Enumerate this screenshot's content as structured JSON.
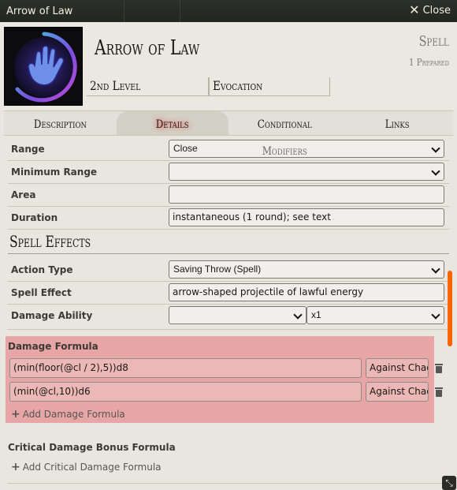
{
  "window": {
    "title": "Arrow of Law",
    "close_label": "Close"
  },
  "header": {
    "name": "Arrow of Law",
    "type": "Spell",
    "status": "1 Prepared",
    "level": "2nd Level",
    "school": "Evocation"
  },
  "tabs": [
    {
      "label": "Description",
      "active": false
    },
    {
      "label": "Details",
      "active": true
    },
    {
      "label": "Conditional Modifiers",
      "active": false
    },
    {
      "label": "Links",
      "active": false
    }
  ],
  "fields": {
    "range": {
      "label": "Range",
      "value": "Close"
    },
    "min_range": {
      "label": "Minimum Range",
      "value": ""
    },
    "area": {
      "label": "Area",
      "value": ""
    },
    "duration": {
      "label": "Duration",
      "value": "instantaneous (1 round); see text"
    }
  },
  "spell_effects": {
    "heading": "Spell Effects",
    "action_type": {
      "label": "Action Type",
      "value": "Saving Throw (Spell)"
    },
    "spell_effect": {
      "label": "Spell Effect",
      "value": "arrow-shaped projectile of lawful energy"
    },
    "damage_ability": {
      "label": "Damage Ability",
      "value": "",
      "multiplier": "x1"
    }
  },
  "damage_formula": {
    "label": "Damage Formula",
    "rows": [
      {
        "formula": "(min(floor(@cl / 2),5))d8",
        "type": "Against Chao"
      },
      {
        "formula": "(min(@cl,10))d6",
        "type": "Against Chao"
      }
    ],
    "add_label": "Add Damage Formula"
  },
  "critical": {
    "label": "Critical Damage Bonus Formula",
    "add_label": "Add Critical Damage Formula"
  },
  "colors": {
    "highlight": "#e8a5a5",
    "scroll_accent": "#ff6400"
  }
}
